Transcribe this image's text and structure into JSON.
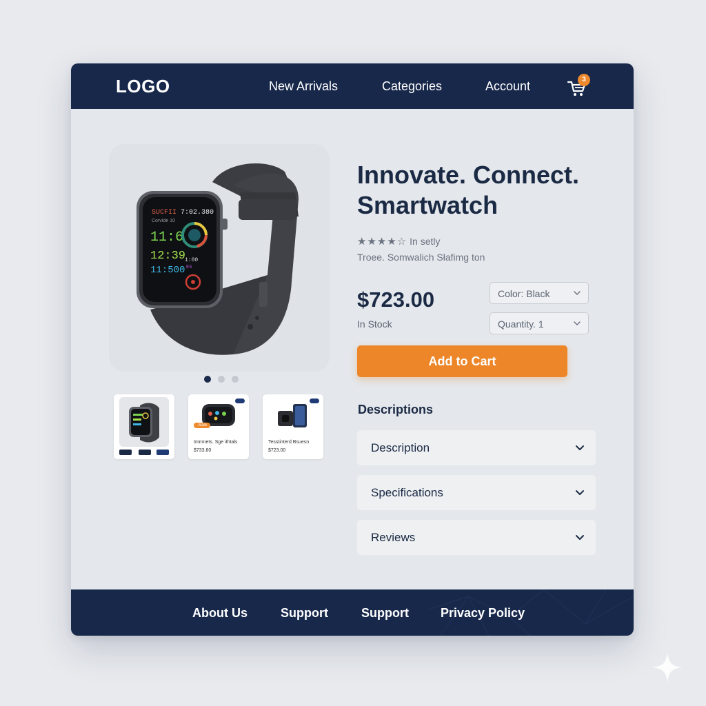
{
  "header": {
    "logo": "LOGO",
    "nav": [
      "New Arrivals",
      "Categories",
      "Account"
    ],
    "cart_count": "3"
  },
  "product": {
    "title_line1": "Innovate. Connect.",
    "title_line2": "Smartwatch",
    "rating_stars": "★★★★☆",
    "rating_text": "In setly",
    "subtitle": "Troее. Somwalich Słafimg ton",
    "price": "$723.00",
    "stock": "In Stock",
    "color_select": "Color: Black",
    "quantity_select": "Quantity. 1",
    "add_to_cart": "Add to Cart"
  },
  "watch_screen": {
    "line1": "SUCFII",
    "line1_right": "7:02.380",
    "line2": "Corvide 10",
    "time1": "11:6",
    "time2": "12:39",
    "time3": "11:500",
    "small_right": "1:00",
    "tiny_right": "ES"
  },
  "gallery": {
    "thumbnails": [
      {
        "title": "",
        "price": ""
      },
      {
        "title": "Immnets. Sge ithtals",
        "price": "$733.80",
        "tag": "-Sale"
      },
      {
        "title": "Tesstinterd Bsuesn",
        "price": "$723.00"
      }
    ]
  },
  "details": {
    "heading": "Descriptions",
    "accordions": [
      "Description",
      "Specifications",
      "Reviews"
    ]
  },
  "footer": {
    "links": [
      "About Us",
      "Support",
      "Support",
      "Privacy Policy"
    ]
  },
  "colors": {
    "navy": "#17284b",
    "accent_orange": "#ec8628",
    "background": "#e4e7eb"
  },
  "icons": [
    "cart-icon",
    "chevron-down-icon",
    "star-icon",
    "sparkle-icon"
  ]
}
